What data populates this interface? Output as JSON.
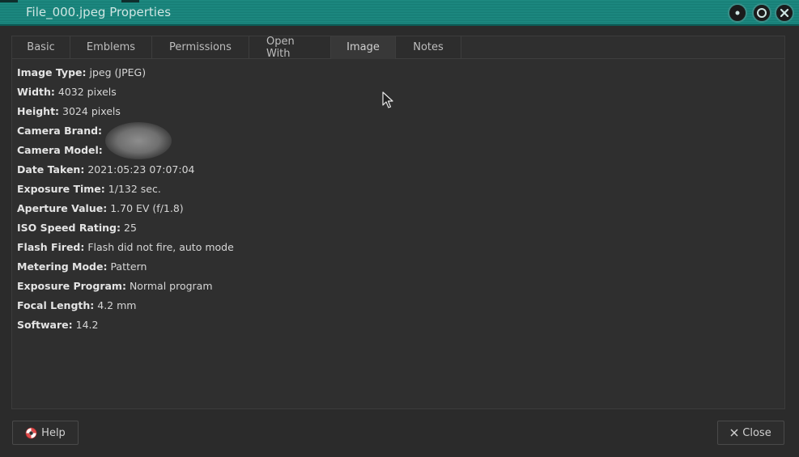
{
  "window": {
    "title": "File_000.jpeg Properties"
  },
  "tabs": [
    {
      "label": "Basic"
    },
    {
      "label": "Emblems"
    },
    {
      "label": "Permissions"
    },
    {
      "label": "Open With"
    },
    {
      "label": "Image"
    },
    {
      "label": "Notes"
    }
  ],
  "active_tab": "Image",
  "properties": [
    {
      "label": "Image Type:",
      "value": "jpeg (JPEG)"
    },
    {
      "label": "Width:",
      "value": "4032 pixels"
    },
    {
      "label": "Height:",
      "value": "3024 pixels"
    },
    {
      "label": "Camera Brand:",
      "value": ""
    },
    {
      "label": "Camera Model:",
      "value": ""
    },
    {
      "label": "Date Taken:",
      "value": "2021:05:23 07:07:04"
    },
    {
      "label": "Exposure Time:",
      "value": "1/132 sec."
    },
    {
      "label": "Aperture Value:",
      "value": "1.70 EV (f/1.8)"
    },
    {
      "label": "ISO Speed Rating:",
      "value": "25"
    },
    {
      "label": "Flash Fired:",
      "value": "Flash did not fire, auto mode"
    },
    {
      "label": "Metering Mode:",
      "value": "Pattern"
    },
    {
      "label": "Exposure Program:",
      "value": "Normal program"
    },
    {
      "label": "Focal Length:",
      "value": "4.2 mm"
    },
    {
      "label": "Software:",
      "value": "14.2"
    }
  ],
  "buttons": {
    "help_label": "Help",
    "close_label": "Close"
  },
  "colors": {
    "titlebar": "#1f8d84",
    "background": "#2b2b2b",
    "help_icon": "#e04a4a"
  }
}
